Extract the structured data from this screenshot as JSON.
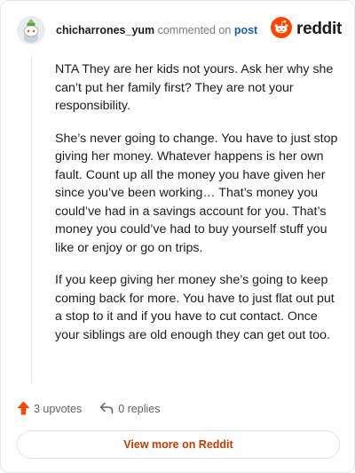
{
  "comment": {
    "author": "chicharrones_yum",
    "action": "commented on",
    "target": "post",
    "brand": "reddit",
    "paragraphs": [
      "NTA They are her kids not yours. Ask her why she can’t put her family first? They are not your responsibility.",
      "She’s never going to change. You have to just stop giving her money. Whatever happens is her own fault. Count up all the money you have given her since you’ve been working… That’s money you could’ve had in a savings account for you. That’s money you could’ve had to buy yourself stuff you like or enjoy or go on trips.",
      "If you keep giving her money she’s going to keep coming back for more. You have to just flat out put a stop to it and if you have to cut contact. Once your siblings are old enough they can get out too."
    ],
    "upvotes": "3 upvotes",
    "replies": "0 replies",
    "view_more": "View more on Reddit"
  },
  "icons": {
    "avatar": "snoo-avatar-icon",
    "logo": "reddit-logo-icon",
    "upvote": "upvote-arrow-icon",
    "reply": "reply-arrow-icon"
  },
  "colors": {
    "brand": "#FF4500",
    "link": "#1A5FB4",
    "view_more_text": "#C23C00"
  }
}
